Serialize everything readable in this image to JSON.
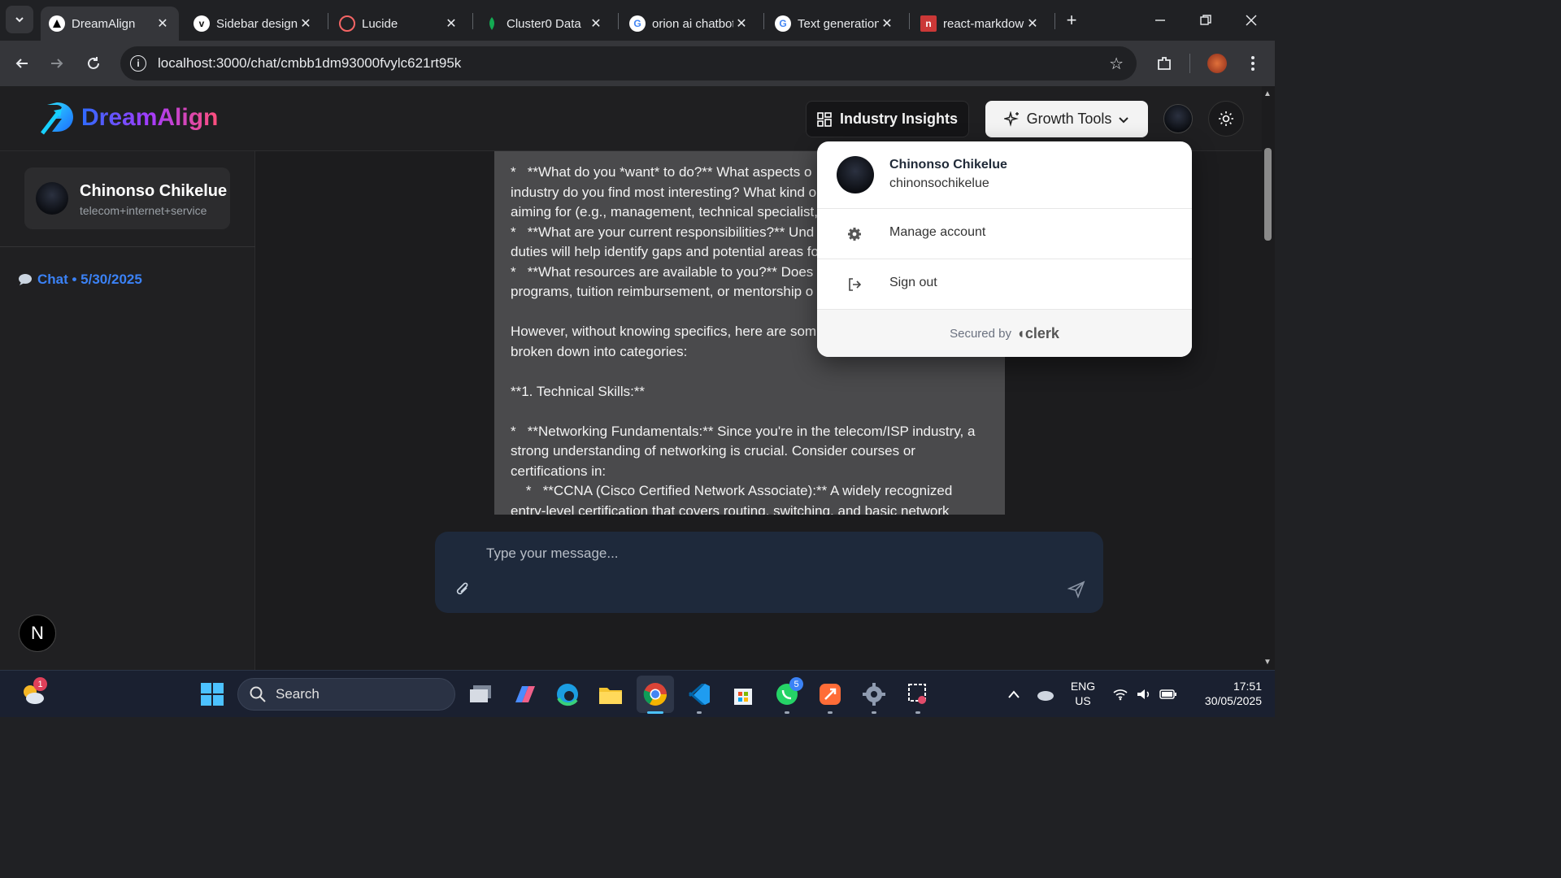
{
  "browser": {
    "tabs": [
      {
        "title": "DreamAlign",
        "active": true
      },
      {
        "title": "Sidebar design"
      },
      {
        "title": "Lucide"
      },
      {
        "title": "Cluster0 Data"
      },
      {
        "title": "orion ai chatbot"
      },
      {
        "title": "Text generation"
      },
      {
        "title": "react-markdown"
      }
    ],
    "url": "localhost:3000/chat/cmbb1dm93000fvylc621rt95k"
  },
  "app": {
    "logo_text": "DreamAlign",
    "industry_insights_label": "Industry Insights",
    "growth_tools_label": "Growth Tools",
    "sidebar": {
      "profile_name": "Chinonso Chikelue",
      "profile_industry": "telecom+internet+service",
      "chat_link": "Chat • 5/30/2025",
      "n_badge": "N"
    },
    "message_lines": [
      "*   **What do you *want* to do?** What aspects o",
      "industry do you find most interesting? What kind o",
      "aiming for (e.g., management, technical specialist,",
      "*   **What are your current responsibilities?** Und",
      "duties will help identify gaps and potential areas fo",
      "*   **What resources are available to you?** Does y",
      "programs, tuition reimbursement, or mentorship o",
      "",
      "However, without knowing specifics, here are som",
      "broken down into categories:",
      "",
      "**1. Technical Skills:**",
      "",
      "*   **Networking Fundamentals:** Since you're in the telecom/ISP industry, a",
      "strong understanding of networking is crucial. Consider courses or",
      "certifications in:",
      "    *   **CCNA (Cisco Certified Network Associate):** A widely recognized",
      "entry-level certification that covers routing, switching, and basic network"
    ],
    "composer_placeholder": "Type your message...",
    "account_menu": {
      "name": "Chinonso Chikelue",
      "username": "chinonsochikelue",
      "manage_account": "Manage account",
      "sign_out": "Sign out",
      "secured_by": "Secured by",
      "clerk": "clerk"
    }
  },
  "taskbar": {
    "search_label": "Search",
    "weather_badge": "1",
    "whatsapp_badge": "5",
    "lang_top": "ENG",
    "lang_bottom": "US",
    "time": "17:51",
    "date": "30/05/2025"
  }
}
